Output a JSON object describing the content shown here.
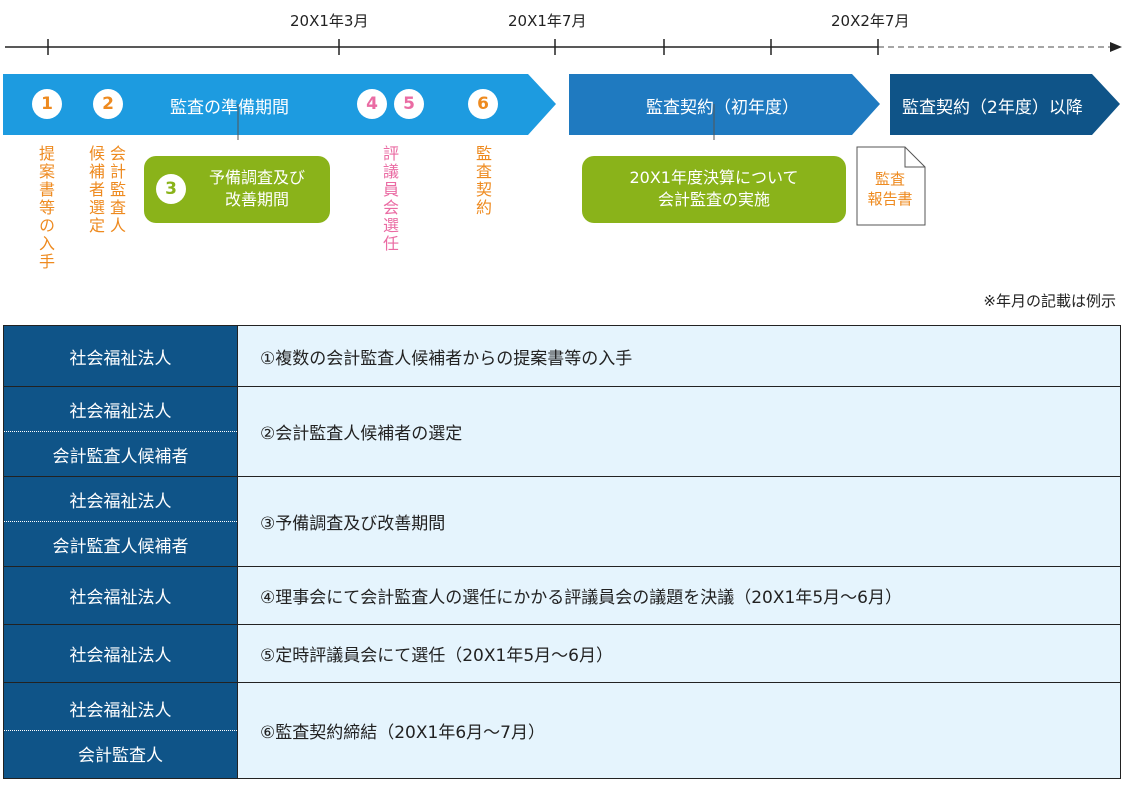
{
  "timeline": {
    "dates": [
      "20X1年3月",
      "20X1年7月",
      "20X2年7月"
    ],
    "phases": [
      "監査の準備期間",
      "監査契約（初年度）",
      "監査契約（2年度）以降"
    ]
  },
  "steps": {
    "n1": "1",
    "n2": "2",
    "n3": "3",
    "n4": "4",
    "n5": "5",
    "n6": "6",
    "s1_label": "提案書等の入手",
    "s2_label_a": "会計監査人",
    "s2_label_b": "候補者選定",
    "s3_label_a": "予備調査及び",
    "s3_label_b": "改善期間",
    "s45_label": "評議員会選任",
    "s6_label": "監査契約"
  },
  "audit_box": {
    "line1": "20X1年度決算について",
    "line2": "会計監査の実施"
  },
  "report": {
    "line1": "監査",
    "line2": "報告書"
  },
  "note": "※年月の記載は例示",
  "table": {
    "rows": [
      {
        "who": [
          "社会福祉法人"
        ],
        "what": "①複数の会計監査人候補者からの提案書等の入手"
      },
      {
        "who": [
          "社会福祉法人",
          "会計監査人候補者"
        ],
        "what": "②会計監査人候補者の選定"
      },
      {
        "who": [
          "社会福祉法人",
          "会計監査人候補者"
        ],
        "what": "③予備調査及び改善期間"
      },
      {
        "who": [
          "社会福祉法人"
        ],
        "what": "④理事会にて会計監査人の選任にかかる評議員会の議題を決議（20X1年5月～6月）"
      },
      {
        "who": [
          "社会福祉法人"
        ],
        "what": "⑤定時評議員会にて選任（20X1年5月～6月）"
      },
      {
        "who": [
          "社会福祉法人",
          "会計監査人"
        ],
        "what": "⑥監査契約締結（20X1年6月～7月）"
      }
    ]
  },
  "colors": {
    "phase1": "#1d9be0",
    "phase2": "#1f7ac0",
    "phase3": "#0f5488",
    "orange": "#ee8a1f",
    "pink": "#ea6ba3",
    "green": "#8ab31a",
    "table_head": "#0f5488",
    "table_body": "#e5f4fd"
  }
}
